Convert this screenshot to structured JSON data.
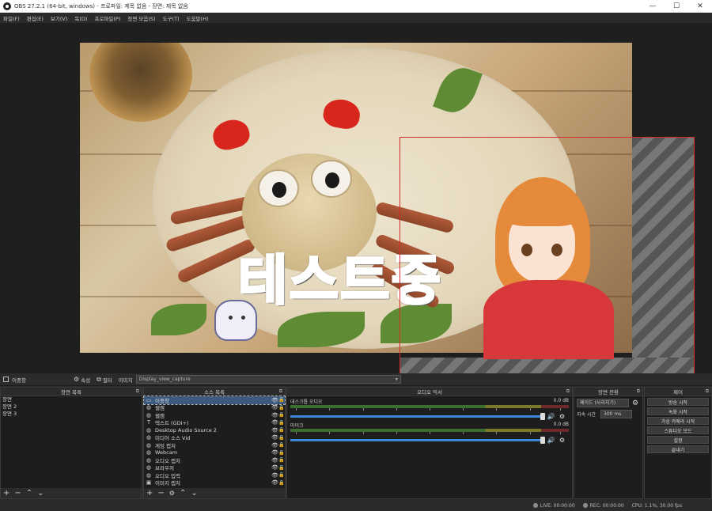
{
  "window": {
    "title": "OBS 27.2.1 (64-bit, windows) - 프로파일: 제목 없음 - 장면: 제목 없음",
    "minimize": "—",
    "maximize": "☐",
    "close": "✕"
  },
  "menu": [
    "파일(F)",
    "편집(E)",
    "보기(V)",
    "독(D)",
    "프로파일(P)",
    "장면 모음(S)",
    "도구(T)",
    "도움말(H)"
  ],
  "canvas_text": "테스트중",
  "dock_strip": {
    "label": "이중창",
    "properties": "속성",
    "filters": "필터",
    "image_label": "이미지",
    "image_value": "Display_view_capture"
  },
  "scenes_panel": {
    "title": "장면 목록",
    "items": [
      "장면",
      "장면 2",
      "장면 3"
    ]
  },
  "sources_panel": {
    "title": "소스 목록",
    "items": [
      {
        "name": "이중창",
        "icon": "window-icon",
        "glyph": "▭",
        "selected": true
      },
      {
        "name": "웹캠",
        "icon": "globe-icon",
        "glyph": "◍",
        "selected": false
      },
      {
        "name": "웹캠",
        "icon": "globe-icon",
        "glyph": "◍",
        "selected": false
      },
      {
        "name": "텍스트 (GDI+)",
        "icon": "text-icon",
        "glyph": "T",
        "selected": false
      },
      {
        "name": "Desktop Audio Source 2",
        "icon": "globe-icon",
        "glyph": "◍",
        "selected": false
      },
      {
        "name": "미디어 소스 Vid",
        "icon": "globe-icon",
        "glyph": "◍",
        "selected": false
      },
      {
        "name": "게임 캡처",
        "icon": "globe-icon",
        "glyph": "◍",
        "selected": false
      },
      {
        "name": "Webcam",
        "icon": "globe-icon",
        "glyph": "◍",
        "selected": false
      },
      {
        "name": "오디오 캡처",
        "icon": "globe-icon",
        "glyph": "◍",
        "selected": false
      },
      {
        "name": "브라우저",
        "icon": "globe-icon",
        "glyph": "◍",
        "selected": false
      },
      {
        "name": "오디오 입력",
        "icon": "globe-icon",
        "glyph": "◍",
        "selected": false
      },
      {
        "name": "이미지 캡처",
        "icon": "image-icon",
        "glyph": "▣",
        "selected": false
      }
    ]
  },
  "mixer_panel": {
    "title": "오디오 믹서",
    "tracks": [
      {
        "name": "데스크톱 오디오",
        "level": "0.0 dB"
      },
      {
        "name": "마이크",
        "level": "0.0 dB"
      }
    ]
  },
  "transitions_panel": {
    "title": "장면 전환",
    "type": "페이드 (사라지기)",
    "duration_label": "지속 시간",
    "duration_value": "300 ms"
  },
  "controls_panel": {
    "title": "제어",
    "buttons": [
      "방송 시작",
      "녹화 시작",
      "가상 카메라 시작",
      "스튜디오 모드",
      "설정",
      "끝내기"
    ]
  },
  "statusbar": {
    "live": "LIVE: 00:00:00",
    "rec": "REC: 00:00:00",
    "cpu": "CPU: 1.1%, 30.00 fps"
  }
}
